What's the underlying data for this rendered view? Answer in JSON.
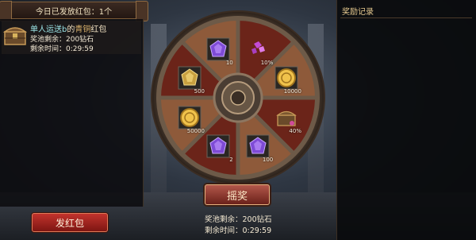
{
  "header": {
    "packets_sent_label": "今日已发放红包：1个"
  },
  "packet": {
    "sender": "单人运送b",
    "title_mid": "的",
    "grade": "青铜",
    "title_suffix": "红包",
    "pool_left": "奖池剩余：200钻石",
    "time_left": "剩余时间：0:29:59"
  },
  "send_button": {
    "label": "发红包"
  },
  "right_panel": {
    "title": "奖励记录"
  },
  "wheel": {
    "spin_label": "摇奖",
    "pool_left": "奖池剩余：200钻石",
    "time_left": "剩余时间：0:29:59",
    "rewards": [
      {
        "name": "diamond-10pct-icon",
        "label": "10%"
      },
      {
        "name": "gold-coins-10000-icon",
        "label": "10000"
      },
      {
        "name": "treasure-chest-icon",
        "label": "40%"
      },
      {
        "name": "purple-gem-100-icon",
        "label": "100"
      },
      {
        "name": "purple-gem-2-icon",
        "label": "2"
      },
      {
        "name": "gold-coins-50000-icon",
        "label": "50000"
      },
      {
        "name": "gold-gem-500-icon",
        "label": "500"
      },
      {
        "name": "purple-gem-10-icon",
        "label": "10"
      }
    ]
  },
  "colors": {
    "wood_dark": "#6b2419",
    "wood_light": "#8e5a3a",
    "frame": "#6d5a48",
    "accent_red": "#c2332d",
    "gold": "#f0c24b",
    "purple": "#7e4bd6"
  }
}
